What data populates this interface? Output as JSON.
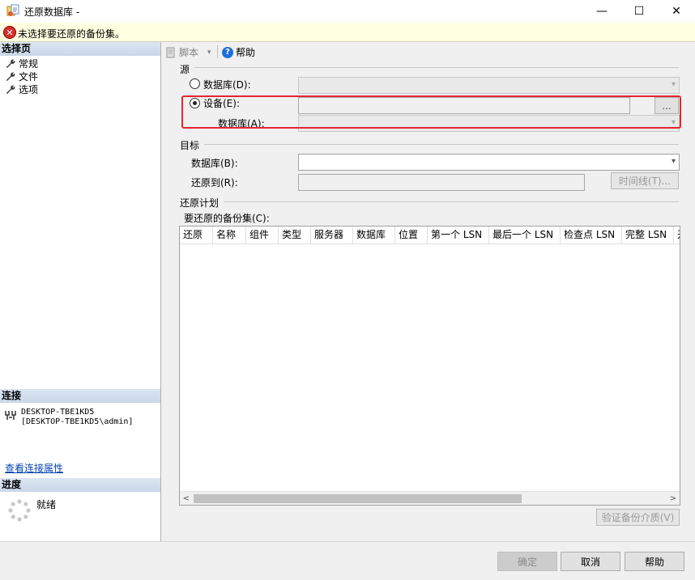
{
  "window": {
    "title": "还原数据库 -",
    "minimize": "—",
    "maximize": "☐",
    "close": "✕"
  },
  "error": {
    "icon": "x-circle-icon",
    "message": "未选择要还原的备份集。"
  },
  "left": {
    "select_page_title": "选择页",
    "pages": [
      "常规",
      "文件",
      "选项"
    ],
    "connection_title": "连接",
    "connection_text": "DESKTOP-TBE1KD5\n[DESKTOP-TBE1KD5\\admin]",
    "connection_link": "查看连接属性",
    "progress_title": "进度",
    "progress_status": "就绪"
  },
  "toolbar": {
    "script_label": "脚本",
    "script_arrow": "▾",
    "help_label": "帮助",
    "help_glyph": "?"
  },
  "source": {
    "title": "源",
    "database_radio": "数据库(D):",
    "device_radio": "设备(E):",
    "device_browse": "...",
    "device_database_label": "数据库(A):",
    "selected": "device"
  },
  "target": {
    "title": "目标",
    "database_label": "数据库(B):",
    "restore_to_label": "还原到(R):",
    "timeline_button": "时间线(T)..."
  },
  "plan": {
    "title": "还原计划",
    "backup_sets_label": "要还原的备份集(C):",
    "columns": [
      "还原",
      "名称",
      "组件",
      "类型",
      "服务器",
      "数据库",
      "位置",
      "第一个 LSN",
      "最后一个 LSN",
      "检查点 LSN",
      "完整 LSN",
      "开"
    ],
    "verify_button": "验证备份介质(V)"
  },
  "footer": {
    "ok": "确定",
    "cancel": "取消",
    "help": "帮助"
  },
  "colors": {
    "highlight": "#e5262e",
    "section_header": "#c9d7e8",
    "error_bg": "#ffffe1"
  }
}
